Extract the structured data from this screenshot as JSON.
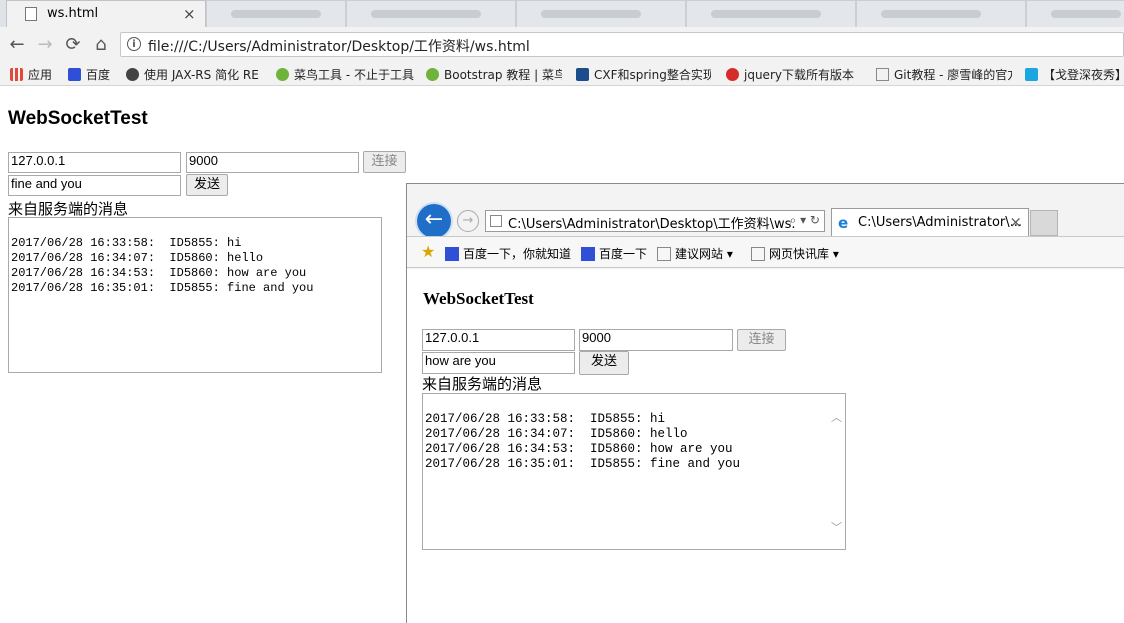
{
  "chrome": {
    "active_tab": {
      "title": "ws.html",
      "close": "×"
    },
    "nav": {
      "back": "←",
      "forward": "→",
      "reload": "⟳",
      "home": "⌂"
    },
    "url": "file:///C:/Users/Administrator/Desktop/工作资料/ws.html",
    "bookmarks": [
      {
        "label": "应用",
        "icon": "apps-grid-icon",
        "color": "#e04a3a"
      },
      {
        "label": "百度",
        "icon": "baidu-paw-icon",
        "color": "#2e4fd6"
      },
      {
        "label": "使用 JAX-RS 简化 RE",
        "icon": "share-icon",
        "color": "#444444"
      },
      {
        "label": "菜鸟工具 - 不止于工具",
        "icon": "runoob-icon",
        "color": "#6fb33c"
      },
      {
        "label": "Bootstrap 教程 | 菜鸟",
        "icon": "runoob-icon",
        "color": "#6fb33c"
      },
      {
        "label": "CXF和spring整合实现",
        "icon": "cnblogs-icon",
        "color": "#1b4c8c"
      },
      {
        "label": "jquery下载所有版本（",
        "icon": "q-icon",
        "color": "#d62b2b"
      },
      {
        "label": "Git教程 - 廖雪峰的官方",
        "icon": "page-icon",
        "color": "#888888"
      },
      {
        "label": "【戈登深夜秀】",
        "icon": "bilibili-icon",
        "color": "#1aa6e0"
      }
    ],
    "page": {
      "title": "WebSocketTest",
      "host": "127.0.0.1",
      "port": "9000",
      "connect": "连接",
      "message": "fine and you",
      "send": "发送",
      "label": "来自服务端的消息",
      "log": "2017/06/28 16:33:58:  ID5855: hi\n2017/06/28 16:34:07:  ID5860: hello\n2017/06/28 16:34:53:  ID5860: how are you\n2017/06/28 16:35:01:  ID5855: fine and you"
    }
  },
  "ie": {
    "back": "←",
    "forward": "→",
    "address": "C:\\Users\\Administrator\\Desktop\\工作资料\\ws.",
    "address_tools": "⌕ ▾ ↻",
    "tab_title": "C:\\Users\\Administrator\\...",
    "tab_close": "×",
    "favorites": [
      {
        "label": "百度一下，你就知道",
        "icon": "baidu-paw-icon"
      },
      {
        "label": "百度一下",
        "icon": "baidu-paw-icon"
      },
      {
        "label": "建议网站 ▾",
        "icon": "ie-page-icon"
      },
      {
        "label": "网页快讯库 ▾",
        "icon": "ie-page-icon"
      }
    ],
    "page": {
      "title": "WebSocketTest",
      "host": "127.0.0.1",
      "port": "9000",
      "connect": "连接",
      "message": "how are you",
      "send": "发送",
      "label": "来自服务端的消息",
      "log": "2017/06/28 16:33:58:  ID5855: hi\n2017/06/28 16:34:07:  ID5860: hello\n2017/06/28 16:34:53:  ID5860: how are you\n2017/06/28 16:35:01:  ID5855: fine and you"
    }
  }
}
